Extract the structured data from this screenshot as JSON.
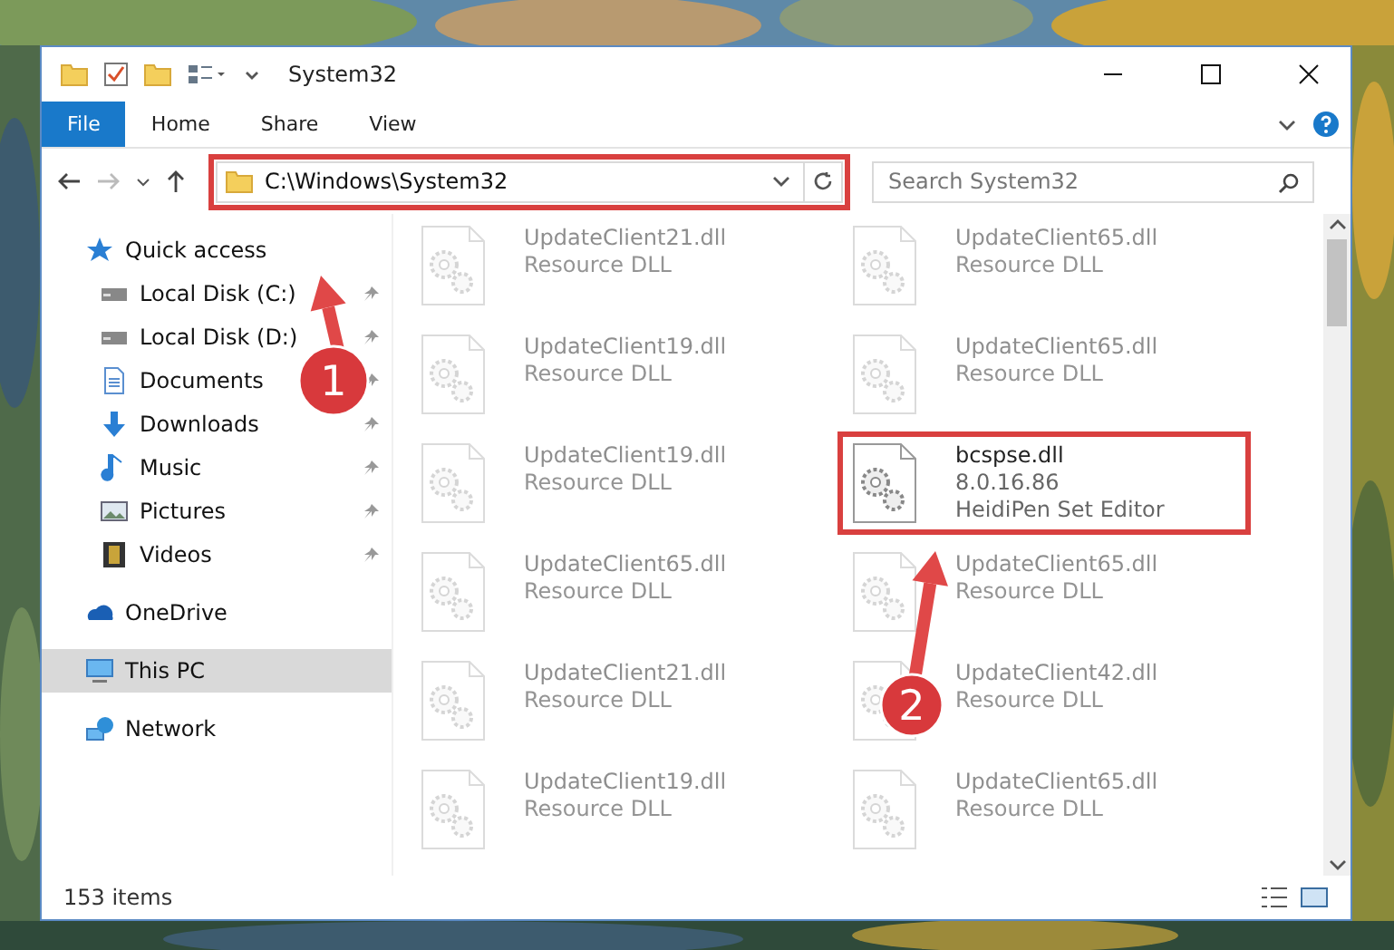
{
  "window": {
    "title": "System32"
  },
  "ribbon": {
    "tabs": [
      {
        "label": "File",
        "selected": true
      },
      {
        "label": "Home",
        "selected": false
      },
      {
        "label": "Share",
        "selected": false
      },
      {
        "label": "View",
        "selected": false
      }
    ]
  },
  "address": {
    "path": "C:\\Windows\\System32",
    "highlighted": true
  },
  "search": {
    "placeholder": "Search System32"
  },
  "sidebar": {
    "items": [
      {
        "label": "Quick access",
        "kind": "star",
        "selected": false,
        "children": [
          {
            "label": "Local Disk (C:)",
            "kind": "disk",
            "pinned": true
          },
          {
            "label": "Local Disk (D:)",
            "kind": "disk",
            "pinned": true
          },
          {
            "label": "Documents",
            "kind": "doc",
            "pinned": true
          },
          {
            "label": "Downloads",
            "kind": "download",
            "pinned": true
          },
          {
            "label": "Music",
            "kind": "music",
            "pinned": true
          },
          {
            "label": "Pictures",
            "kind": "pictures",
            "pinned": true
          },
          {
            "label": "Videos",
            "kind": "videos",
            "pinned": true
          }
        ]
      },
      {
        "label": "OneDrive",
        "kind": "cloud",
        "selected": false
      },
      {
        "label": "This PC",
        "kind": "pc",
        "selected": true
      },
      {
        "label": "Network",
        "kind": "network",
        "selected": false
      }
    ]
  },
  "files": [
    {
      "name": "UpdateClient21.dll",
      "lines": [
        "Resource DLL"
      ],
      "kind": "faded"
    },
    {
      "name": "UpdateClient65.dll",
      "lines": [
        "Resource DLL"
      ],
      "kind": "faded"
    },
    {
      "name": "UpdateClient19.dll",
      "lines": [
        "Resource DLL"
      ],
      "kind": "faded"
    },
    {
      "name": "UpdateClient65.dll",
      "lines": [
        "Resource DLL"
      ],
      "kind": "faded"
    },
    {
      "name": "UpdateClient19.dll",
      "lines": [
        "Resource DLL"
      ],
      "kind": "faded"
    },
    {
      "name": "bcspse.dll",
      "lines": [
        "8.0.16.86",
        "HeidiPen Set Editor"
      ],
      "kind": "focus"
    },
    {
      "name": "UpdateClient65.dll",
      "lines": [
        "Resource DLL"
      ],
      "kind": "faded"
    },
    {
      "name": "UpdateClient65.dll",
      "lines": [
        "Resource DLL"
      ],
      "kind": "faded"
    },
    {
      "name": "UpdateClient21.dll",
      "lines": [
        "Resource DLL"
      ],
      "kind": "faded"
    },
    {
      "name": "UpdateClient42.dll",
      "lines": [
        "Resource DLL"
      ],
      "kind": "faded"
    },
    {
      "name": "UpdateClient19.dll",
      "lines": [
        "Resource DLL"
      ],
      "kind": "faded"
    },
    {
      "name": "UpdateClient65.dll",
      "lines": [
        "Resource DLL"
      ],
      "kind": "faded"
    }
  ],
  "status_bar": {
    "count": "153 items"
  },
  "annotations": [
    {
      "label": "1"
    },
    {
      "label": "2"
    }
  ]
}
